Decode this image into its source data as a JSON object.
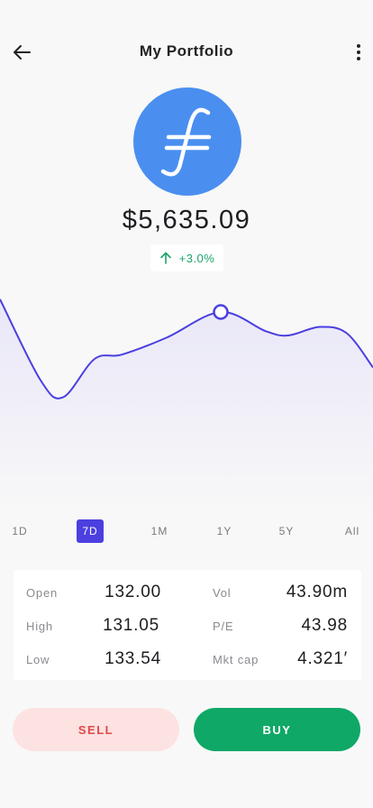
{
  "header": {
    "title": "My Portfolio",
    "back_icon": "arrow-left-icon",
    "menu_icon": "more-vertical-icon"
  },
  "asset": {
    "logo_icon": "filecoin-logo-icon",
    "logo_color": "#4a8ff0",
    "balance": "$5,635.09",
    "change": "+3.0%",
    "change_icon": "arrow-up-icon",
    "change_color": "#1ba36a"
  },
  "chart_data": {
    "type": "area",
    "series_color": "#4b3fe0",
    "grid": false,
    "highlighted_point_index": 6,
    "values": [
      100,
      62,
      54,
      72,
      74,
      82,
      94,
      85,
      83,
      87,
      84,
      68
    ]
  },
  "ranges": {
    "items": [
      "1D",
      "7D",
      "1M",
      "1Y",
      "5Y",
      "All"
    ],
    "active": "7D"
  },
  "stats": {
    "open_label": "Open",
    "open_value": "132.00",
    "high_label": "High",
    "high_value": "131.05",
    "low_label": "Low",
    "low_value": "133.54",
    "vol_label": "Vol",
    "vol_value": "43.90m",
    "pe_label": "P/E",
    "pe_value": "43.98",
    "mktcap_label": "Mkt cap",
    "mktcap_value": "4.321′"
  },
  "actions": {
    "sell_label": "SELL",
    "buy_label": "BUY",
    "sell_color": "#e04848",
    "buy_color": "#0fa866"
  }
}
